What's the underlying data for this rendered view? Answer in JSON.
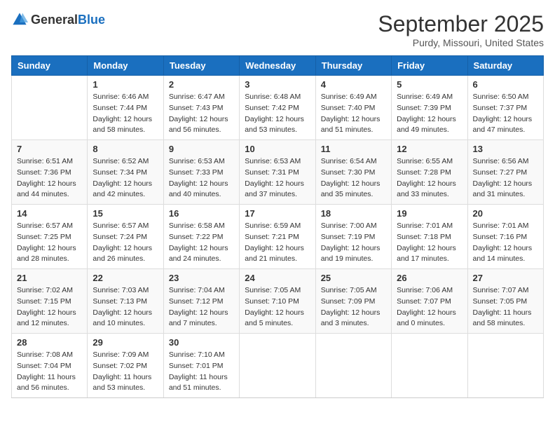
{
  "logo": {
    "general": "General",
    "blue": "Blue"
  },
  "header": {
    "month": "September 2025",
    "location": "Purdy, Missouri, United States"
  },
  "weekdays": [
    "Sunday",
    "Monday",
    "Tuesday",
    "Wednesday",
    "Thursday",
    "Friday",
    "Saturday"
  ],
  "weeks": [
    [
      {
        "day": "",
        "info": ""
      },
      {
        "day": "1",
        "info": "Sunrise: 6:46 AM\nSunset: 7:44 PM\nDaylight: 12 hours\nand 58 minutes."
      },
      {
        "day": "2",
        "info": "Sunrise: 6:47 AM\nSunset: 7:43 PM\nDaylight: 12 hours\nand 56 minutes."
      },
      {
        "day": "3",
        "info": "Sunrise: 6:48 AM\nSunset: 7:42 PM\nDaylight: 12 hours\nand 53 minutes."
      },
      {
        "day": "4",
        "info": "Sunrise: 6:49 AM\nSunset: 7:40 PM\nDaylight: 12 hours\nand 51 minutes."
      },
      {
        "day": "5",
        "info": "Sunrise: 6:49 AM\nSunset: 7:39 PM\nDaylight: 12 hours\nand 49 minutes."
      },
      {
        "day": "6",
        "info": "Sunrise: 6:50 AM\nSunset: 7:37 PM\nDaylight: 12 hours\nand 47 minutes."
      }
    ],
    [
      {
        "day": "7",
        "info": "Sunrise: 6:51 AM\nSunset: 7:36 PM\nDaylight: 12 hours\nand 44 minutes."
      },
      {
        "day": "8",
        "info": "Sunrise: 6:52 AM\nSunset: 7:34 PM\nDaylight: 12 hours\nand 42 minutes."
      },
      {
        "day": "9",
        "info": "Sunrise: 6:53 AM\nSunset: 7:33 PM\nDaylight: 12 hours\nand 40 minutes."
      },
      {
        "day": "10",
        "info": "Sunrise: 6:53 AM\nSunset: 7:31 PM\nDaylight: 12 hours\nand 37 minutes."
      },
      {
        "day": "11",
        "info": "Sunrise: 6:54 AM\nSunset: 7:30 PM\nDaylight: 12 hours\nand 35 minutes."
      },
      {
        "day": "12",
        "info": "Sunrise: 6:55 AM\nSunset: 7:28 PM\nDaylight: 12 hours\nand 33 minutes."
      },
      {
        "day": "13",
        "info": "Sunrise: 6:56 AM\nSunset: 7:27 PM\nDaylight: 12 hours\nand 31 minutes."
      }
    ],
    [
      {
        "day": "14",
        "info": "Sunrise: 6:57 AM\nSunset: 7:25 PM\nDaylight: 12 hours\nand 28 minutes."
      },
      {
        "day": "15",
        "info": "Sunrise: 6:57 AM\nSunset: 7:24 PM\nDaylight: 12 hours\nand 26 minutes."
      },
      {
        "day": "16",
        "info": "Sunrise: 6:58 AM\nSunset: 7:22 PM\nDaylight: 12 hours\nand 24 minutes."
      },
      {
        "day": "17",
        "info": "Sunrise: 6:59 AM\nSunset: 7:21 PM\nDaylight: 12 hours\nand 21 minutes."
      },
      {
        "day": "18",
        "info": "Sunrise: 7:00 AM\nSunset: 7:19 PM\nDaylight: 12 hours\nand 19 minutes."
      },
      {
        "day": "19",
        "info": "Sunrise: 7:01 AM\nSunset: 7:18 PM\nDaylight: 12 hours\nand 17 minutes."
      },
      {
        "day": "20",
        "info": "Sunrise: 7:01 AM\nSunset: 7:16 PM\nDaylight: 12 hours\nand 14 minutes."
      }
    ],
    [
      {
        "day": "21",
        "info": "Sunrise: 7:02 AM\nSunset: 7:15 PM\nDaylight: 12 hours\nand 12 minutes."
      },
      {
        "day": "22",
        "info": "Sunrise: 7:03 AM\nSunset: 7:13 PM\nDaylight: 12 hours\nand 10 minutes."
      },
      {
        "day": "23",
        "info": "Sunrise: 7:04 AM\nSunset: 7:12 PM\nDaylight: 12 hours\nand 7 minutes."
      },
      {
        "day": "24",
        "info": "Sunrise: 7:05 AM\nSunset: 7:10 PM\nDaylight: 12 hours\nand 5 minutes."
      },
      {
        "day": "25",
        "info": "Sunrise: 7:05 AM\nSunset: 7:09 PM\nDaylight: 12 hours\nand 3 minutes."
      },
      {
        "day": "26",
        "info": "Sunrise: 7:06 AM\nSunset: 7:07 PM\nDaylight: 12 hours\nand 0 minutes."
      },
      {
        "day": "27",
        "info": "Sunrise: 7:07 AM\nSunset: 7:05 PM\nDaylight: 11 hours\nand 58 minutes."
      }
    ],
    [
      {
        "day": "28",
        "info": "Sunrise: 7:08 AM\nSunset: 7:04 PM\nDaylight: 11 hours\nand 56 minutes."
      },
      {
        "day": "29",
        "info": "Sunrise: 7:09 AM\nSunset: 7:02 PM\nDaylight: 11 hours\nand 53 minutes."
      },
      {
        "day": "30",
        "info": "Sunrise: 7:10 AM\nSunset: 7:01 PM\nDaylight: 11 hours\nand 51 minutes."
      },
      {
        "day": "",
        "info": ""
      },
      {
        "day": "",
        "info": ""
      },
      {
        "day": "",
        "info": ""
      },
      {
        "day": "",
        "info": ""
      }
    ]
  ]
}
